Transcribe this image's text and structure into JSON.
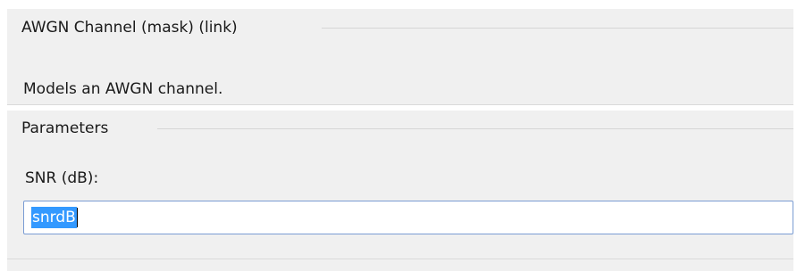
{
  "mask_group": {
    "legend": "AWGN Channel (mask) (link)",
    "description": "Models an AWGN channel."
  },
  "parameters_group": {
    "legend": "Parameters",
    "snr": {
      "label": "SNR (dB):",
      "value": "snrdB",
      "selected": true
    }
  },
  "colors": {
    "panel_background": "#f0f0f0",
    "selection_highlight": "#3399ff",
    "input_border": "#7a9cd3"
  }
}
